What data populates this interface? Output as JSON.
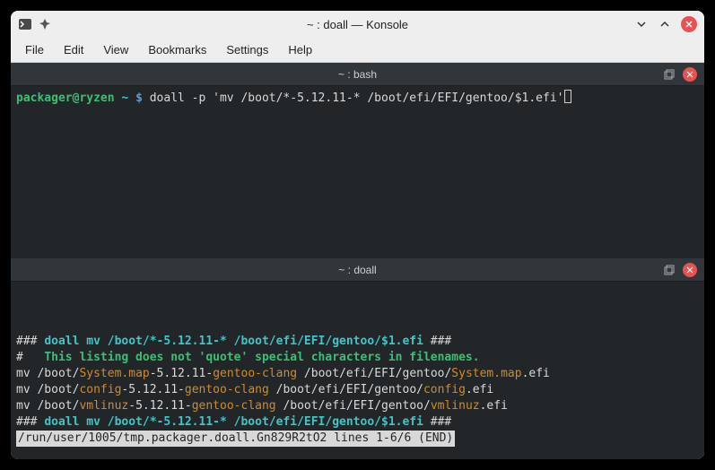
{
  "window": {
    "title": "~ : doall — Konsole"
  },
  "menu": {
    "file": "File",
    "edit": "Edit",
    "view": "View",
    "bookmarks": "Bookmarks",
    "settings": "Settings",
    "help": "Help"
  },
  "tabs": {
    "top": {
      "label": "~ : bash"
    },
    "bottom": {
      "label": "~ : doall"
    }
  },
  "term1": {
    "user_host": "packager@ryzen",
    "cwd": "~",
    "prompt": "$",
    "command": "doall -p 'mv /boot/*-5.12.11-* /boot/efi/EFI/gentoo/$1.efi'"
  },
  "term2": {
    "header_hashes_open": "### ",
    "header_cmd": "doall mv /boot/*-5.12.11-* /boot/efi/EFI/gentoo/$1.efi",
    "header_hashes_close": " ###",
    "note_prefix": "#   ",
    "note": "This listing does not 'quote' special characters in filenames.",
    "lines": [
      {
        "pre": "mv /boot/",
        "file": "System.map",
        "mid": "-5.12.11-",
        "suffix": "gentoo-clang",
        "post1": " /boot/efi/EFI/gentoo/",
        "file2": "System.map",
        "post2": ".efi"
      },
      {
        "pre": "mv /boot/",
        "file": "config",
        "mid": "-5.12.11-",
        "suffix": "gentoo-clang",
        "post1": " /boot/efi/EFI/gentoo/",
        "file2": "config",
        "post2": ".efi"
      },
      {
        "pre": "mv /boot/",
        "file": "vmlinuz",
        "mid": "-5.12.11-",
        "suffix": "gentoo-clang",
        "post1": " /boot/efi/EFI/gentoo/",
        "file2": "vmlinuz",
        "post2": ".efi"
      }
    ],
    "footer_hashes_open": "### ",
    "footer_cmd": "doall mv /boot/*-5.12.11-* /boot/efi/EFI/gentoo/$1.efi",
    "footer_hashes_close": " ###",
    "status": "/run/user/1005/tmp.packager.doall.Gn829R2tO2 lines 1-6/6 (END)"
  }
}
